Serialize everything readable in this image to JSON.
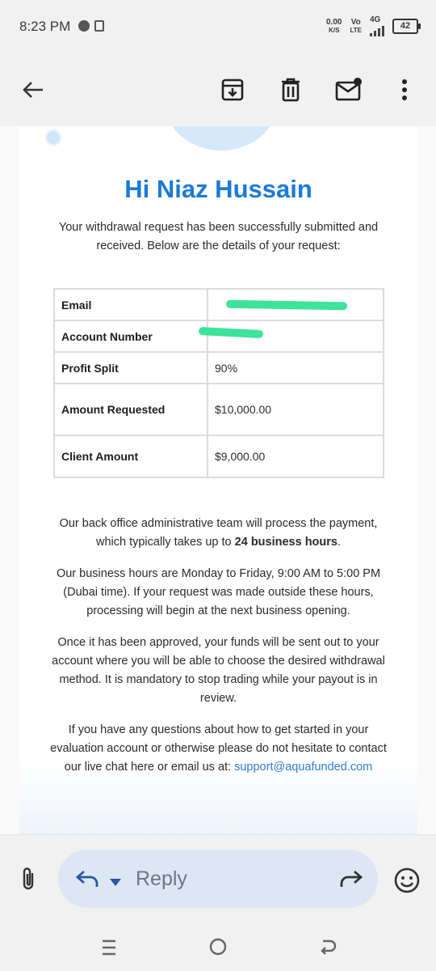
{
  "status_bar": {
    "time": "8:23 PM",
    "net_speed_value": "0.00",
    "net_speed_unit": "K/S",
    "volte_top": "Vo",
    "volte_bottom": "LTE",
    "network_type": "4G",
    "battery_level": "42"
  },
  "toolbar": {
    "back_icon": "back-arrow-icon",
    "archive_icon": "archive-icon",
    "delete_icon": "trash-icon",
    "mark_unread_icon": "mark-unread-icon",
    "more_icon": "more-vert-icon"
  },
  "email": {
    "greeting": "Hi Niaz Hussain",
    "intro": "Your withdrawal request has been successfully submitted and received. Below are the details of your request:",
    "details": [
      {
        "label": "Email",
        "value": ""
      },
      {
        "label": "Account Number",
        "value": ""
      },
      {
        "label": "Profit Split",
        "value": "90%"
      },
      {
        "label": "Amount Requested",
        "value": "$10,000.00"
      },
      {
        "label": "Client Amount",
        "value": "$9,000.00"
      }
    ],
    "para1_a": "Our back office administrative team will process the payment, which typically takes up to ",
    "para1_bold": "24 business hours",
    "para1_b": ".",
    "para2": "Our business hours are Monday to Friday, 9:00 AM to 5:00 PM (Dubai time). If your request was made outside these hours, processing will begin at the next business opening.",
    "para3": "Once it has been approved, your funds will be sent out to your account where you will be able to choose the desired withdrawal method. It is mandatory to stop trading while your payout is in review.",
    "para4": "If you have any questions about how to get started in your evaluation account or otherwise please do not hesitate to contact our live chat here or email us at: ",
    "support_email": "support@aquafunded.com"
  },
  "reply_bar": {
    "reply_label": "Reply"
  },
  "colors": {
    "accent": "#1a7bd6",
    "link": "#2f7fd0",
    "redaction": "#3de39a"
  }
}
